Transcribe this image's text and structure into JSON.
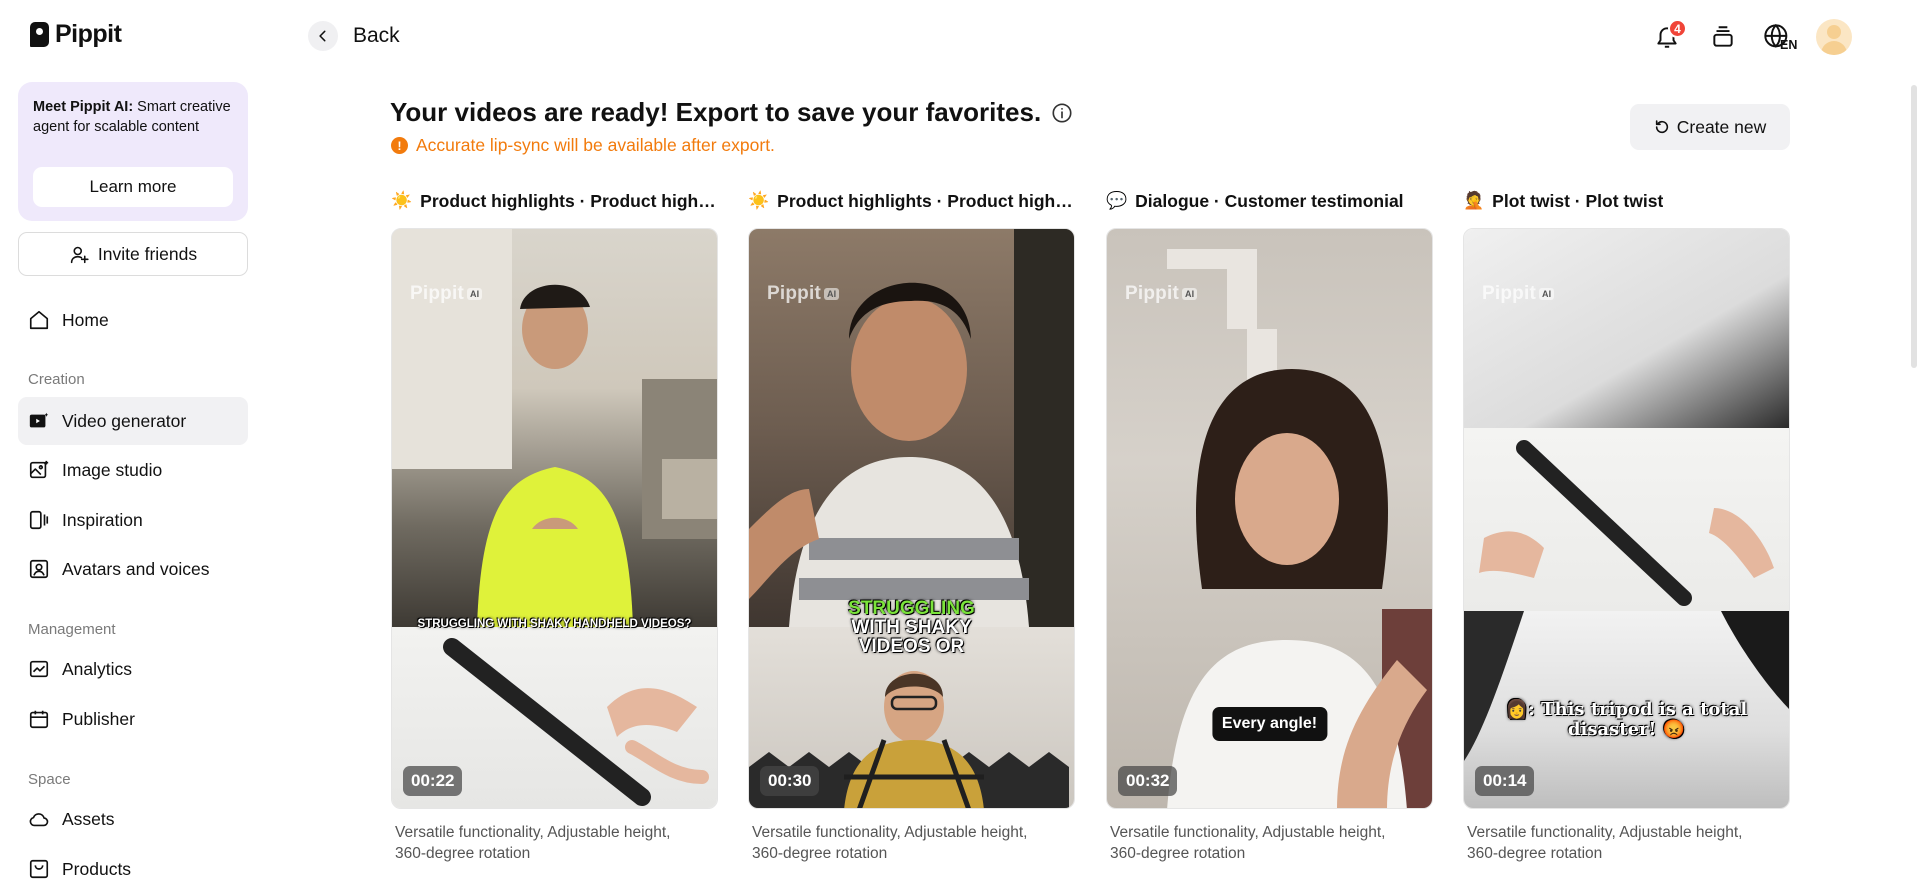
{
  "brand": {
    "name": "Pippit"
  },
  "promo": {
    "title": "Meet Pippit AI:",
    "body": " Smart creative agent for scalable content",
    "button": "Learn more"
  },
  "invite": {
    "label": "Invite friends"
  },
  "nav": {
    "home": "Home",
    "creation_label": "Creation",
    "video_generator": "Video generator",
    "image_studio": "Image studio",
    "inspiration": "Inspiration",
    "avatars_voices": "Avatars and voices",
    "management_label": "Management",
    "analytics": "Analytics",
    "publisher": "Publisher",
    "space_label": "Space",
    "assets": "Assets",
    "products": "Products"
  },
  "header": {
    "back": "Back",
    "notification_count": "4",
    "language": "EN"
  },
  "main": {
    "heading": "Your videos are ready! Export to save your favorites.",
    "notice": "Accurate lip-sync will be available after export.",
    "create_new": "Create new",
    "watermark": "Pippit",
    "watermark_tag": "AI",
    "cards": [
      {
        "emoji": "☀️",
        "title": "Product highlights · Product highli...",
        "duration": "00:22",
        "caption": "STRUGGLING WITH SHAKY HANDHELD VIDEOS?",
        "description": "Versatile functionality, Adjustable height, 360-degree rotation"
      },
      {
        "emoji": "☀️",
        "title": "Product highlights · Product highli...",
        "duration": "00:30",
        "caption_line1": "STRUGGLING",
        "caption_line2": "WITH SHAKY",
        "caption_line3": "VIDEOS OR",
        "description": "Versatile functionality, Adjustable height, 360-degree rotation"
      },
      {
        "emoji": "💬",
        "title": "Dialogue · Customer testimonial",
        "duration": "00:32",
        "caption": "Every angle!",
        "description": "Versatile functionality, Adjustable height, 360-degree rotation"
      },
      {
        "emoji": "🤦",
        "title": "Plot twist · Plot twist",
        "duration": "00:14",
        "caption_line1": "👩: This tripod is a total",
        "caption_line2": "disaster! 😡",
        "description": "Versatile functionality, Adjustable height, 360-degree rotation"
      }
    ]
  }
}
